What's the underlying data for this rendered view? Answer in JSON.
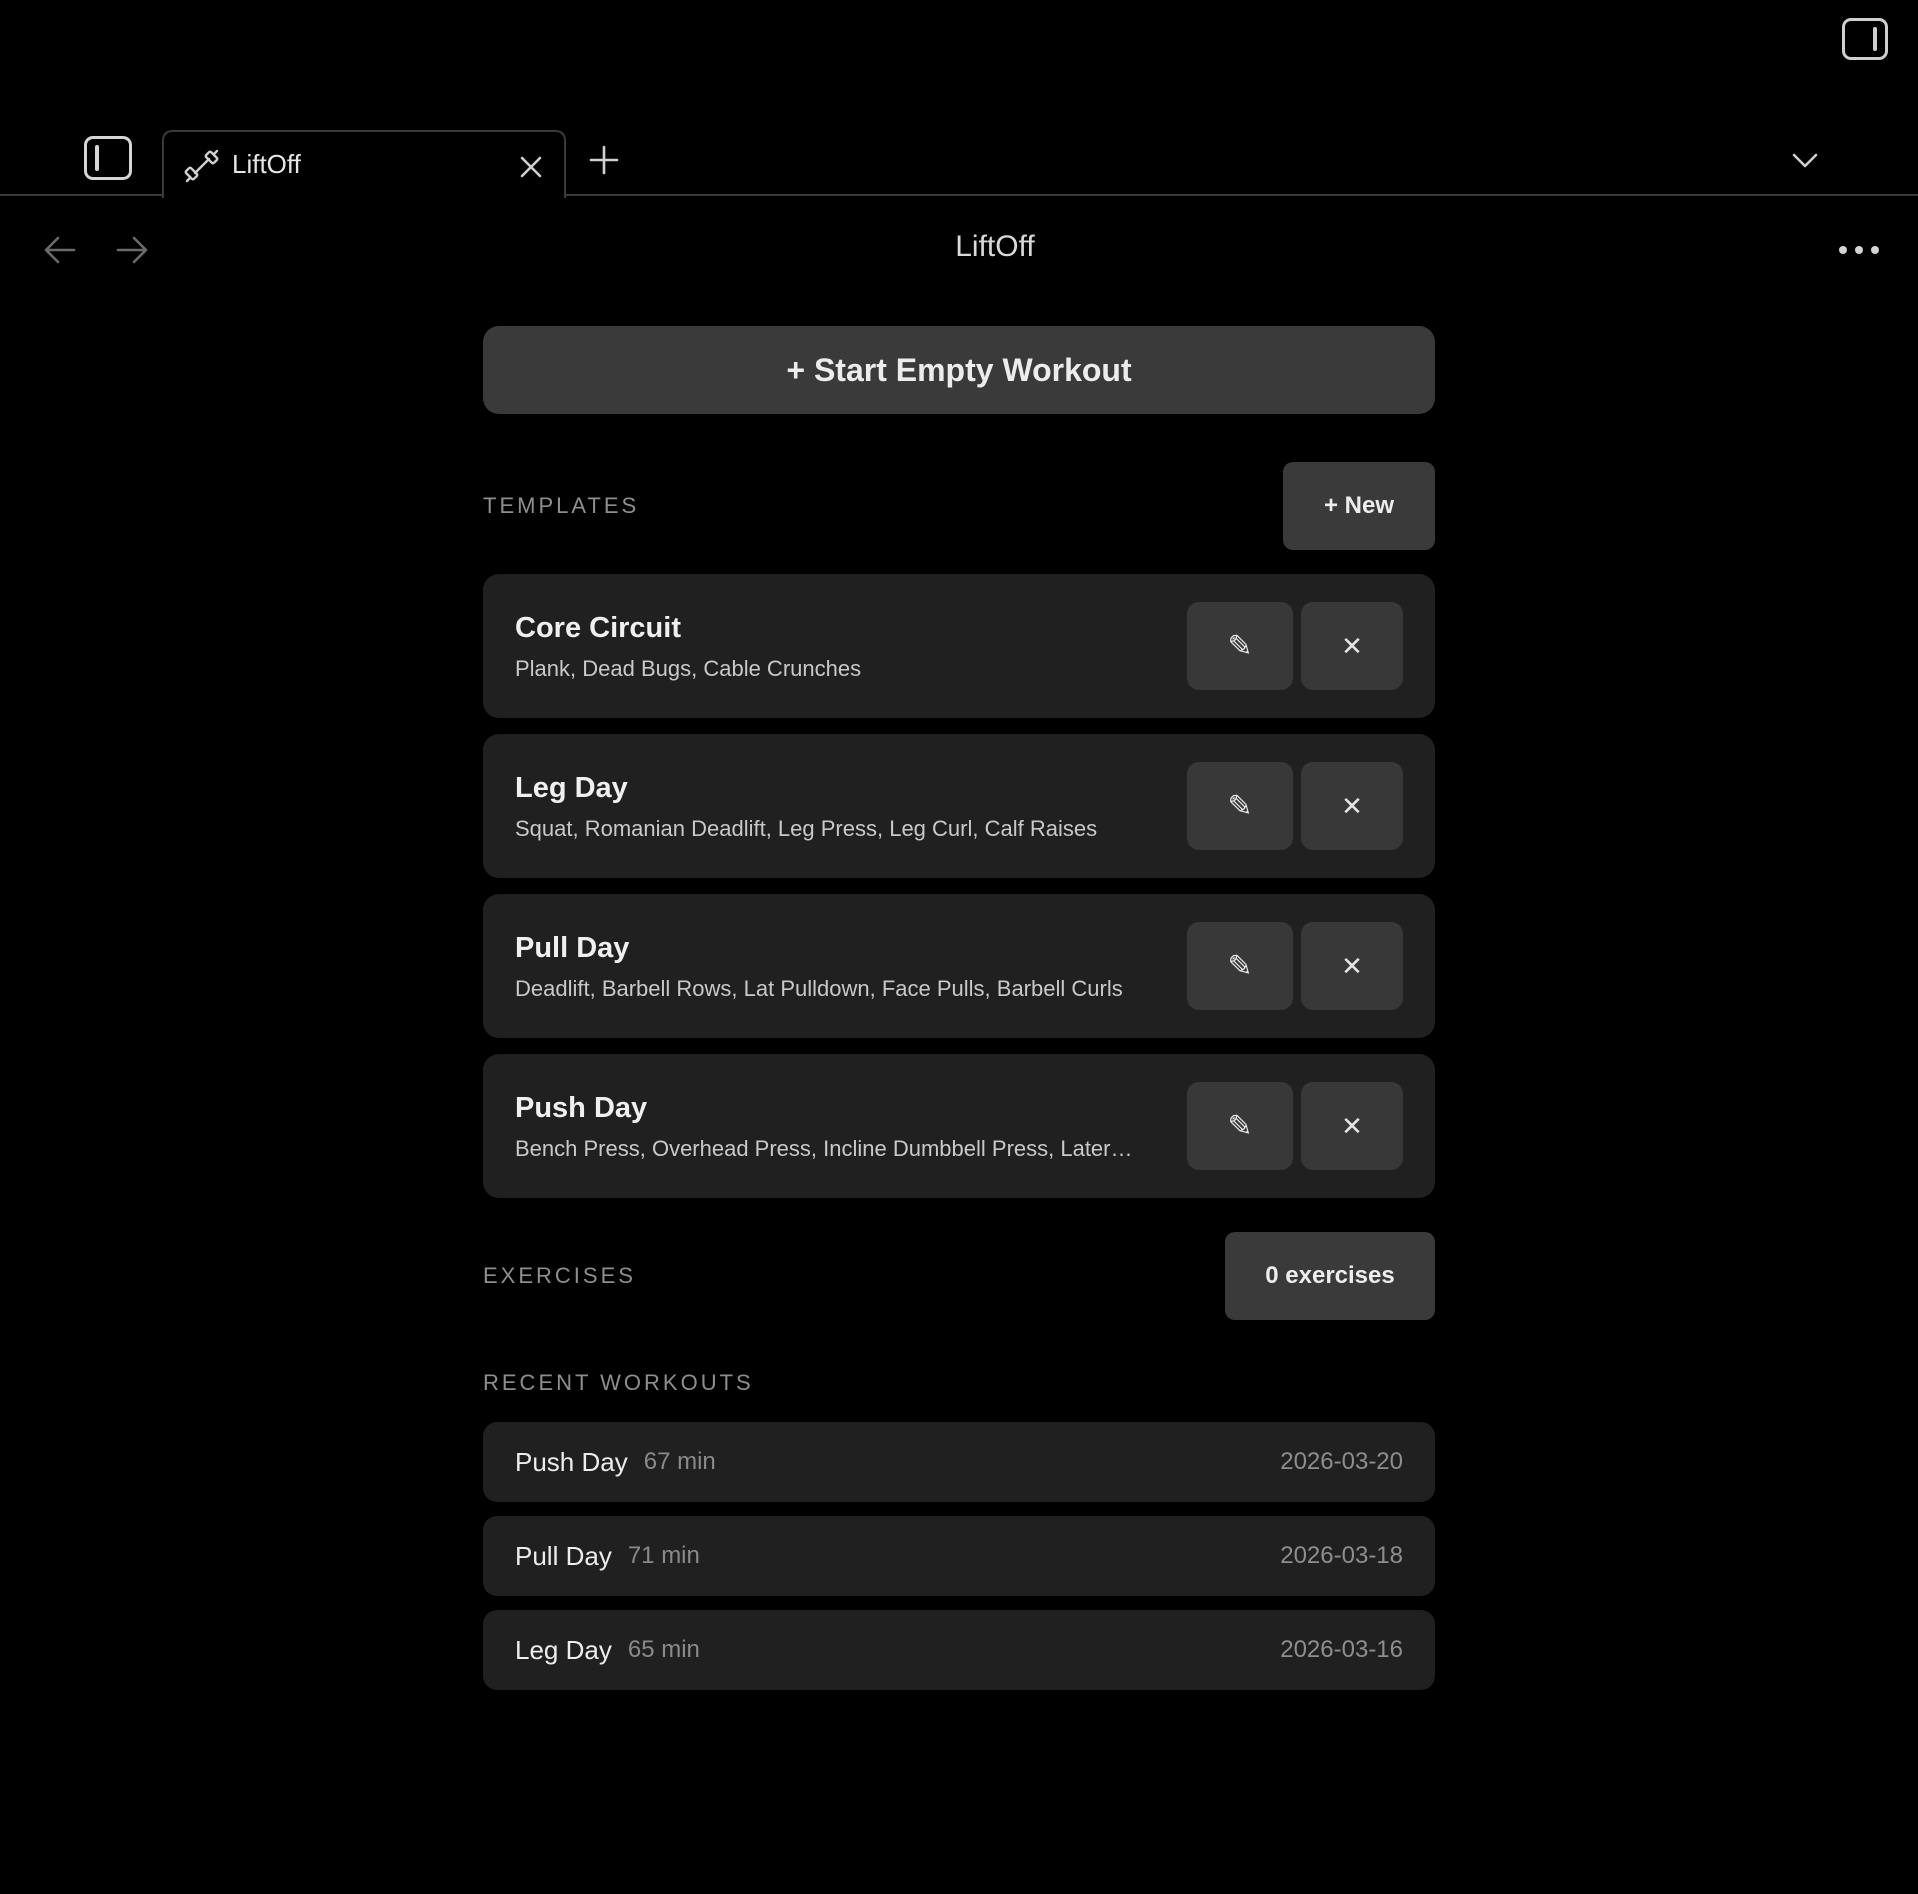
{
  "tab": {
    "title": "LiftOff",
    "icon": "dumbbell-icon"
  },
  "header": {
    "title": "LiftOff"
  },
  "main": {
    "start_button_label": "+ Start Empty Workout",
    "templates": {
      "label": "TEMPLATES",
      "new_button_label": "+ New",
      "items": [
        {
          "name": "Core Circuit",
          "exercises": "Plank, Dead Bugs, Cable Crunches",
          "edit_icon": "✎",
          "delete_icon": "✕"
        },
        {
          "name": "Leg Day",
          "exercises": "Squat, Romanian Deadlift, Leg Press, Leg Curl, Calf Raises",
          "edit_icon": "✎",
          "delete_icon": "✕"
        },
        {
          "name": "Pull Day",
          "exercises": "Deadlift, Barbell Rows, Lat Pulldown, Face Pulls, Barbell Curls",
          "edit_icon": "✎",
          "delete_icon": "✕"
        },
        {
          "name": "Push Day",
          "exercises": "Bench Press, Overhead Press, Incline Dumbbell Press, Later…",
          "edit_icon": "✎",
          "delete_icon": "✕"
        }
      ]
    },
    "exercises": {
      "label": "EXERCISES",
      "count_button_label": "0 exercises"
    },
    "recent_workouts": {
      "label": "RECENT WORKOUTS",
      "items": [
        {
          "name": "Push Day",
          "duration": "67 min",
          "date": "2026-03-20"
        },
        {
          "name": "Pull Day",
          "duration": "71 min",
          "date": "2026-03-18"
        },
        {
          "name": "Leg Day",
          "duration": "65 min",
          "date": "2026-03-16"
        }
      ]
    }
  },
  "colors": {
    "background": "#000000",
    "card": "#202020",
    "button": "#3a3a3a",
    "muted_text": "#8e8e8e"
  }
}
